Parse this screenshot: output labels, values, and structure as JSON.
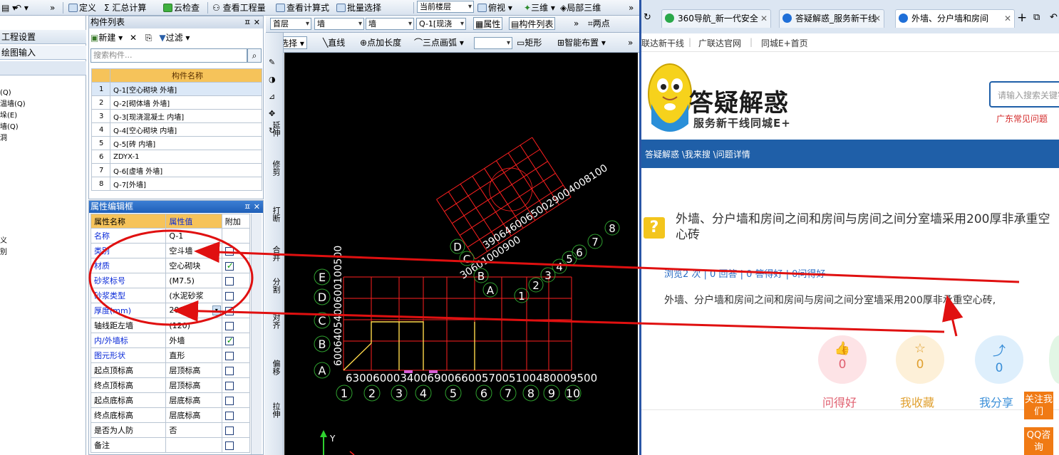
{
  "toolbar": {
    "define": "定义",
    "sum_calc": "汇总计算",
    "cloud_check": "云检查",
    "view_quantity": "查看工程量",
    "view_formula": "查看计算式",
    "batch_select": "批量选择",
    "current_floor": "当前楼层",
    "top_view": "俯视",
    "three_d": "三维",
    "local_3d": "局部三维"
  },
  "leftnav": {
    "project_settings": "工程设置",
    "draw_input": "绘图输入",
    "items": [
      "(Q)",
      "温墙(Q)",
      "垛(E)",
      "墙(Q)",
      "洞",
      "义",
      "别"
    ]
  },
  "component_list": {
    "title": "构件列表",
    "new_label": "新建",
    "filter_label": "过滤",
    "search_placeholder": "搜索构件...",
    "column_header": "构件名称",
    "rows": [
      {
        "num": "1",
        "name": "Q-1[空心砌块 外墙]"
      },
      {
        "num": "2",
        "name": "Q-2[砌体墙 外墙]"
      },
      {
        "num": "3",
        "name": "Q-3[现浇混凝土 内墙]"
      },
      {
        "num": "4",
        "name": "Q-4[空心砌块 内墙]"
      },
      {
        "num": "5",
        "name": "Q-5[砖 内墙]"
      },
      {
        "num": "6",
        "name": "ZDYX-1"
      },
      {
        "num": "7",
        "name": "Q-6[虚墙 外墙]"
      },
      {
        "num": "8",
        "name": "Q-7[外墙]"
      }
    ]
  },
  "properties": {
    "title": "属性编辑框",
    "col_name": "属性名称",
    "col_value": "属性值",
    "col_extra": "附加",
    "rows": [
      {
        "name": "名称",
        "value": "Q-1",
        "checked": null
      },
      {
        "name": "类别",
        "value": "空斗墙",
        "checked": false
      },
      {
        "name": "材质",
        "value": "空心砌块",
        "checked": true
      },
      {
        "name": "砂浆标号",
        "value": "(M7.5)",
        "checked": false
      },
      {
        "name": "砂浆类型",
        "value": "(水泥砂浆",
        "checked": false
      },
      {
        "name": "厚度(mm)",
        "value": "200",
        "checked": false
      },
      {
        "name": "轴线距左墙",
        "value": "(120)",
        "checked": false
      },
      {
        "name": "内/外墙标",
        "value": "外墙",
        "checked": true
      },
      {
        "name": "图元形状",
        "value": "直形",
        "checked": false
      },
      {
        "name": "起点顶标高",
        "value": "层顶标高",
        "checked": false
      },
      {
        "name": "终点顶标高",
        "value": "层顶标高",
        "checked": false
      },
      {
        "name": "起点底标高",
        "value": "层底标高",
        "checked": false
      },
      {
        "name": "终点底标高",
        "value": "层底标高",
        "checked": false
      },
      {
        "name": "是否为人防",
        "value": "否",
        "checked": false
      },
      {
        "name": "备注",
        "value": "",
        "checked": false
      }
    ]
  },
  "drawbar": {
    "floor": "首层",
    "type1": "墙",
    "type2": "墙",
    "component": "Q-1[现浇",
    "attr_btn": "属性",
    "complist_btn": "构件列表",
    "two_points": "两点",
    "select": "选择",
    "line": "直线",
    "point_length": "点加长度",
    "three_arc": "三点画弧",
    "rect": "矩形",
    "smart_layout": "智能布置"
  },
  "vtools": [
    "延伸",
    "修剪",
    "打断",
    "合并",
    "分割",
    "对齐",
    "偏移",
    "拉伸"
  ],
  "canvas": {
    "axis_y": "Y",
    "grid_rows": [
      "E",
      "D",
      "C",
      "B",
      "A"
    ],
    "grid_cols": [
      "1",
      "2",
      "3",
      "4",
      "5",
      "6",
      "7",
      "8",
      "9",
      "10"
    ],
    "bottom_dims": "6300600034006900660057005100480009500",
    "left_dims": "6006405400600100500",
    "rot_rows": [
      "D",
      "C",
      "B",
      "A"
    ],
    "rot_cols": [
      "1",
      "2",
      "3",
      "4",
      "5",
      "6",
      "7",
      "8"
    ],
    "rot_dims_left": "30601000900",
    "rot_dims_top": "39064600650029004008100"
  },
  "browser": {
    "tabs": [
      "360导航_新一代安全",
      "答疑解惑_服务新干线",
      "外墙、分户墙和房间"
    ],
    "links": [
      "联达新干线",
      "广联达官网",
      "同城E+首页"
    ],
    "logo_title": "答疑解惑",
    "logo_sub": "服务新干线同城E+",
    "search_placeholder": "请输入搜索关键字",
    "hot_question": "广东常见问题",
    "breadcrumb": "答疑解惑 \\我来搜 \\问题详情",
    "question_title": "外墙、分户墙和房间之间和房间与房间之间分室墙采用200厚非承重空心砖",
    "stats": "浏览2 次 | 0 回答 | 0 答得好 | 0问得好",
    "body": "外墙、分户墙和房间之间和房间与房间之间分室墙采用200厚非承重空心砖,",
    "actions": [
      {
        "label": "问得好",
        "count": "0",
        "color": "#e06070",
        "bg": "#fde3e6"
      },
      {
        "label": "我收藏",
        "count": "0",
        "color": "#e0a030",
        "bg": "#fdf0d8"
      },
      {
        "label": "我分享",
        "count": "0",
        "color": "#3a8fd8",
        "bg": "#deeffc"
      }
    ],
    "side_follow": "关注我们",
    "side_qq": "QQ咨询"
  },
  "colors": {
    "accent_blue": "#1f5fa8",
    "cad_red": "#ff2020",
    "annotation_red": "#e01010"
  }
}
